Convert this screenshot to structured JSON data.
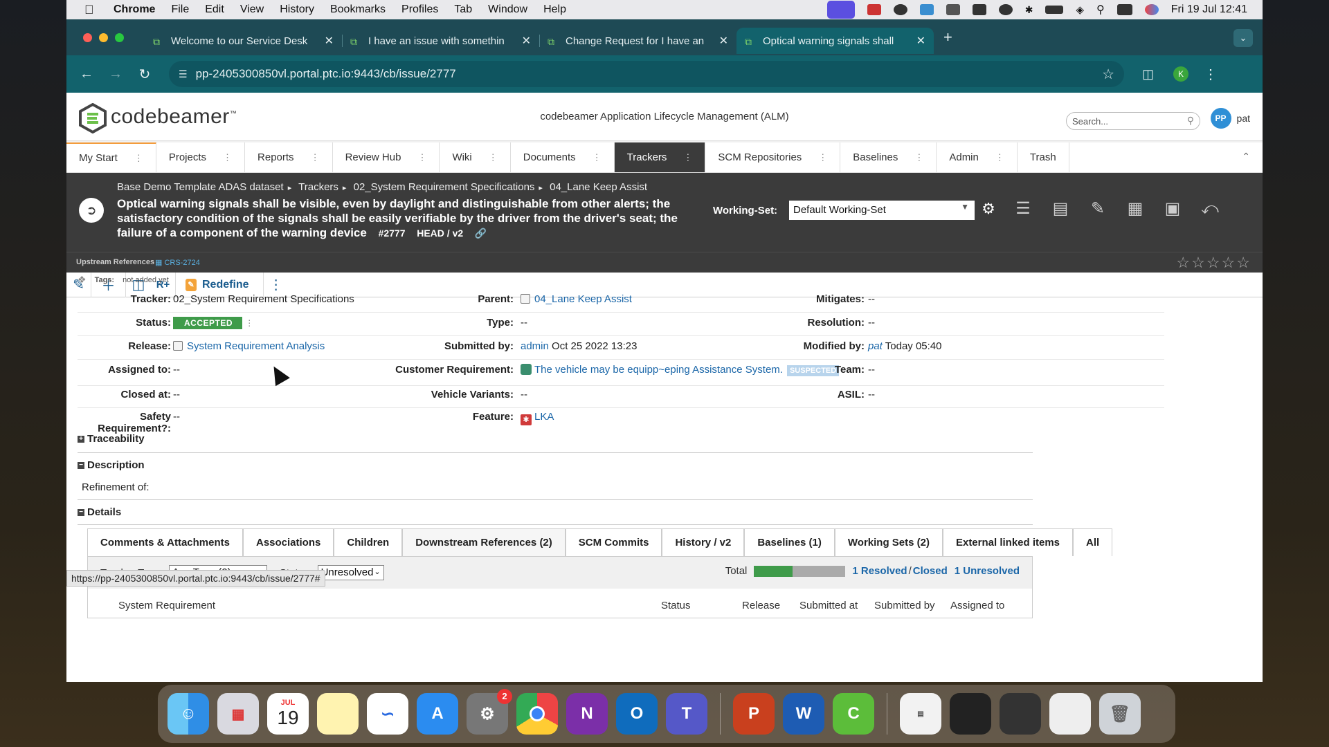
{
  "menubar": {
    "app": "Chrome",
    "items": [
      "File",
      "Edit",
      "View",
      "History",
      "Bookmarks",
      "Profiles",
      "Tab",
      "Window",
      "Help"
    ],
    "clock": "Fri 19 Jul  12:41"
  },
  "browser": {
    "tabs": [
      {
        "title": "Welcome to our Service Desk"
      },
      {
        "title": "I have an issue with somethin"
      },
      {
        "title": "Change Request for I have an"
      },
      {
        "title": "Optical warning signals shall"
      }
    ],
    "url": "pp-2405300850vl.portal.ptc.io:9443/cb/issue/2777",
    "profile_initial": "K",
    "status_url": "https://pp-2405300850vl.portal.ptc.io:9443/cb/issue/2777#"
  },
  "app": {
    "logo": "codebeamer",
    "logo_tm": "™",
    "title": "codebeamer Application Lifecycle Management (ALM)",
    "search_placeholder": "Search...",
    "user_initials": "PP",
    "user_name": "pat"
  },
  "nav": [
    "My Start",
    "Projects",
    "Reports",
    "Review Hub",
    "Wiki",
    "Documents",
    "Trackers",
    "SCM Repositories",
    "Baselines",
    "Admin",
    "Trash"
  ],
  "issue": {
    "breadcrumb": [
      "Base Demo Template ADAS dataset",
      "Trackers",
      "02_System Requirement Specifications",
      "04_Lane Keep Assist"
    ],
    "title": "Optical warning signals shall be visible, even by daylight and distinguishable from other alerts; the satisfactory condition of the signals shall be easily verifiable by the driver from the driver's seat; the failure of a component of the warning device",
    "id": "#2777",
    "version": "HEAD / v2",
    "working_set_label": "Working-Set:",
    "working_set": "Default Working-Set",
    "upstream_label": "Upstream References",
    "upstream_ref": "CRS-2724",
    "redefine_label": "Redefine",
    "tags_label": "Tags:",
    "tags_value": "not added yet"
  },
  "fields": {
    "tracker_label": "Tracker:",
    "tracker": "02_System Requirement Specifications",
    "status_label": "Status:",
    "status": "ACCEPTED",
    "release_label": "Release:",
    "release": "System Requirement Analysis",
    "assigned_label": "Assigned to:",
    "assigned": "--",
    "closed_label": "Closed at:",
    "closed": "--",
    "safety_label": "Safety Requirement?:",
    "safety": "--",
    "parent_label": "Parent:",
    "parent": "04_Lane Keep Assist",
    "type_label": "Type:",
    "type": "--",
    "submitted_label": "Submitted by:",
    "submitted_by": "admin",
    "submitted_at": "Oct 25 2022 13:23",
    "custreq_label": "Customer Requirement:",
    "custreq": "The vehicle may be equipp~eping Assistance System.",
    "custreq_badge": "SUSPECTED",
    "variants_label": "Vehicle Variants:",
    "variants": "--",
    "feature_label": "Feature:",
    "feature": "LKA",
    "mitigates_label": "Mitigates:",
    "mitigates": "--",
    "resolution_label": "Resolution:",
    "resolution": "--",
    "modified_label": "Modified by:",
    "modified_by": "pat",
    "modified_at": "Today 05:40",
    "team_label": "Team:",
    "team": "--",
    "asil_label": "ASIL:",
    "asil": "--"
  },
  "sections": {
    "traceability": "Traceability",
    "description": "Description",
    "refinement": "Refinement of:",
    "details": "Details"
  },
  "detail_tabs": [
    "Comments & Attachments",
    "Associations",
    "Children",
    "Downstream References (2)",
    "SCM Commits",
    "History / v2",
    "Baselines (1)",
    "Working Sets (2)",
    "External linked items",
    "All"
  ],
  "filter": {
    "tracker_type_label": "Tracker Type:",
    "tracker_type": "Any Type (2)",
    "status_label": "Status:",
    "status": "Unresolved",
    "total_label": "Total",
    "resolved_fraction": 0.42,
    "resolved": "1 Resolved",
    "slash": "/",
    "closed": "Closed",
    "unresolved": "1 Unresolved"
  },
  "columns": [
    "System Requirement",
    "Status",
    "Release",
    "Submitted at",
    "Submitted by",
    "Assigned to"
  ],
  "dock": {
    "calendar_month": "JUL",
    "calendar_day": "19",
    "settings_badge": "2"
  }
}
